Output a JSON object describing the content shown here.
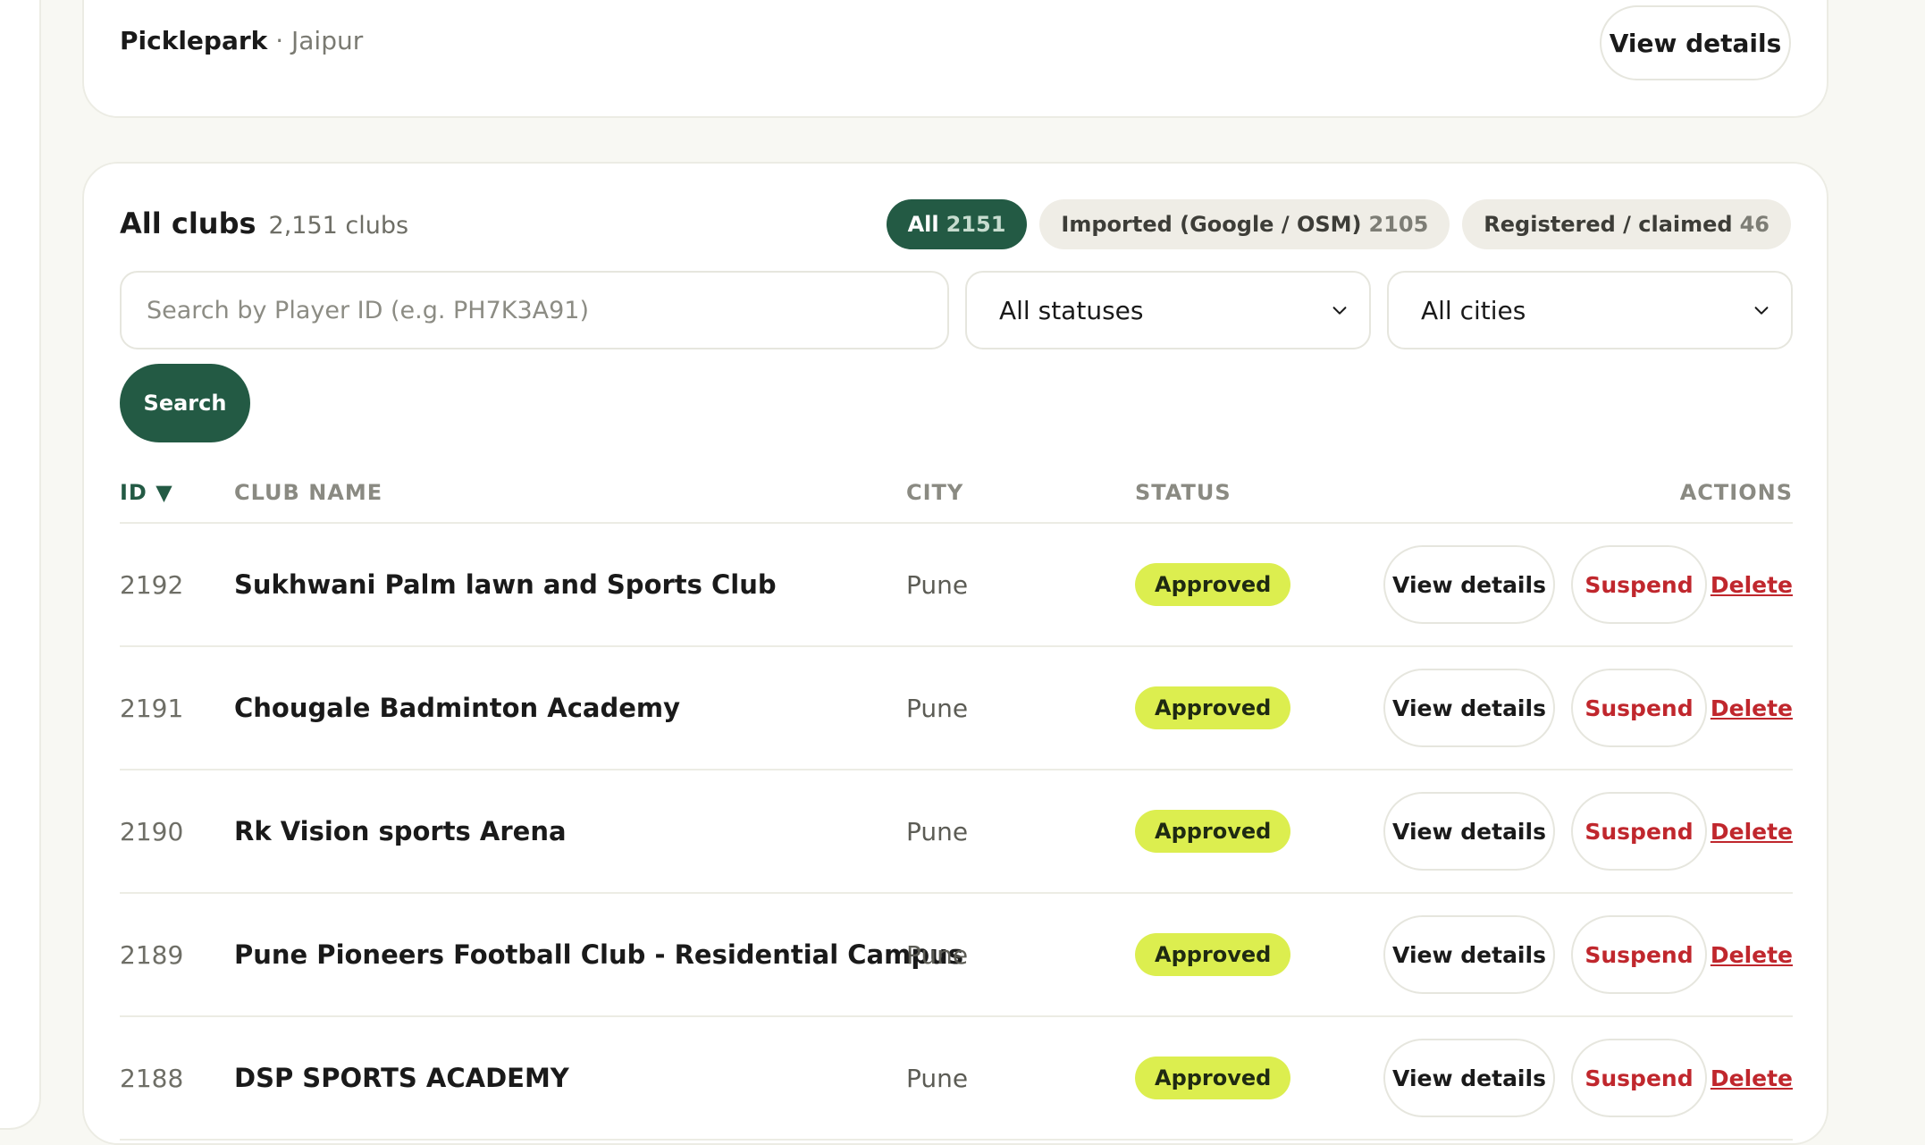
{
  "top_club": {
    "name": "Picklepark",
    "separator": " · ",
    "city": "Jaipur",
    "view_label": "View details"
  },
  "clubs_section": {
    "title": "All clubs",
    "count": "2,151 clubs",
    "tabs": [
      {
        "label": "All",
        "count": "2151",
        "active": true
      },
      {
        "label": "Imported (Google / OSM)",
        "count": "2105",
        "active": false
      },
      {
        "label": "Registered / claimed",
        "count": "46",
        "active": false
      }
    ],
    "search_placeholder": "Search by Player ID (e.g. PH7K3A91)",
    "status_filter": "All statuses",
    "city_filter": "All cities",
    "search_button": "Search"
  },
  "table": {
    "headers": {
      "id": "ID ▼",
      "name": "CLUB NAME",
      "city": "CITY",
      "status": "STATUS",
      "actions": "ACTIONS"
    },
    "rows": [
      {
        "id": "2192",
        "name": "Sukhwani Palm lawn and Sports Club",
        "city": "Pune",
        "status": "Approved",
        "view": "View details",
        "suspend": "Suspend",
        "delete": "Delete"
      },
      {
        "id": "2191",
        "name": "Chougale Badminton Academy",
        "city": "Pune",
        "status": "Approved",
        "view": "View details",
        "suspend": "Suspend",
        "delete": "Delete"
      },
      {
        "id": "2190",
        "name": "Rk Vision sports Arena",
        "city": "Pune",
        "status": "Approved",
        "view": "View details",
        "suspend": "Suspend",
        "delete": "Delete"
      },
      {
        "id": "2189",
        "name": "Pune Pioneers Football Club - Residential Campus",
        "city": "Pune",
        "status": "Approved",
        "view": "View details",
        "suspend": "Suspend",
        "delete": "Delete"
      },
      {
        "id": "2188",
        "name": "DSP SPORTS ACADEMY",
        "city": "Pune",
        "status": "Approved",
        "view": "View details",
        "suspend": "Suspend",
        "delete": "Delete"
      }
    ]
  },
  "colors": {
    "brand": "#235a44",
    "badge": "#dcee4f",
    "danger": "#c0272d",
    "page_bg": "#f8f8f3"
  }
}
